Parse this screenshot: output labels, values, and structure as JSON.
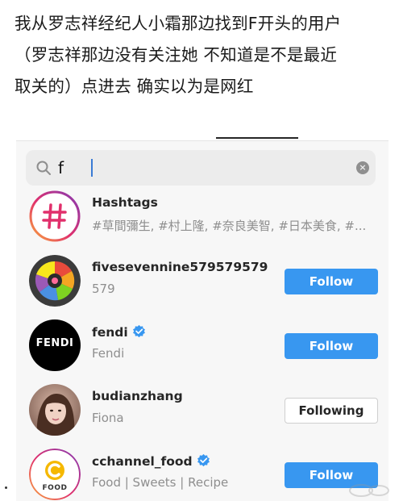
{
  "caption": {
    "lines": [
      "我从罗志祥经纪人小霜那边找到F开头的用户",
      "（罗志祥那边没有关注她 不知道是不是最近",
      "取关的）点进去 确实以为是网红"
    ]
  },
  "search": {
    "value": "f",
    "icon": "search-icon",
    "clear_icon": "clear-icon"
  },
  "results": [
    {
      "name": "Hashtags",
      "sub": "#草間彌生, #村上隆, #奈良美智, #日本美食, #...",
      "avatar": "hashtag",
      "verified": false,
      "button": null
    },
    {
      "name": "fivesevennine579579579",
      "sub": "579",
      "avatar": "colorful-wheel",
      "verified": false,
      "button": "Follow"
    },
    {
      "name": "fendi",
      "sub": "Fendi",
      "avatar": "fendi-logo",
      "avatar_text": "FENDI",
      "verified": true,
      "button": "Follow"
    },
    {
      "name": "budianzhang",
      "sub": "Fiona",
      "avatar": "person-photo",
      "verified": false,
      "button": "Following"
    },
    {
      "name": "cchannel_food",
      "sub": "Food | Sweets | Recipe",
      "avatar": "cchannel-logo",
      "avatar_text": "FOOD",
      "verified": true,
      "button": "Follow"
    }
  ],
  "colors": {
    "follow_blue": "#3897f0",
    "verified_blue": "#3897f0",
    "text_primary": "#262626",
    "text_secondary": "#8e8e8e"
  }
}
